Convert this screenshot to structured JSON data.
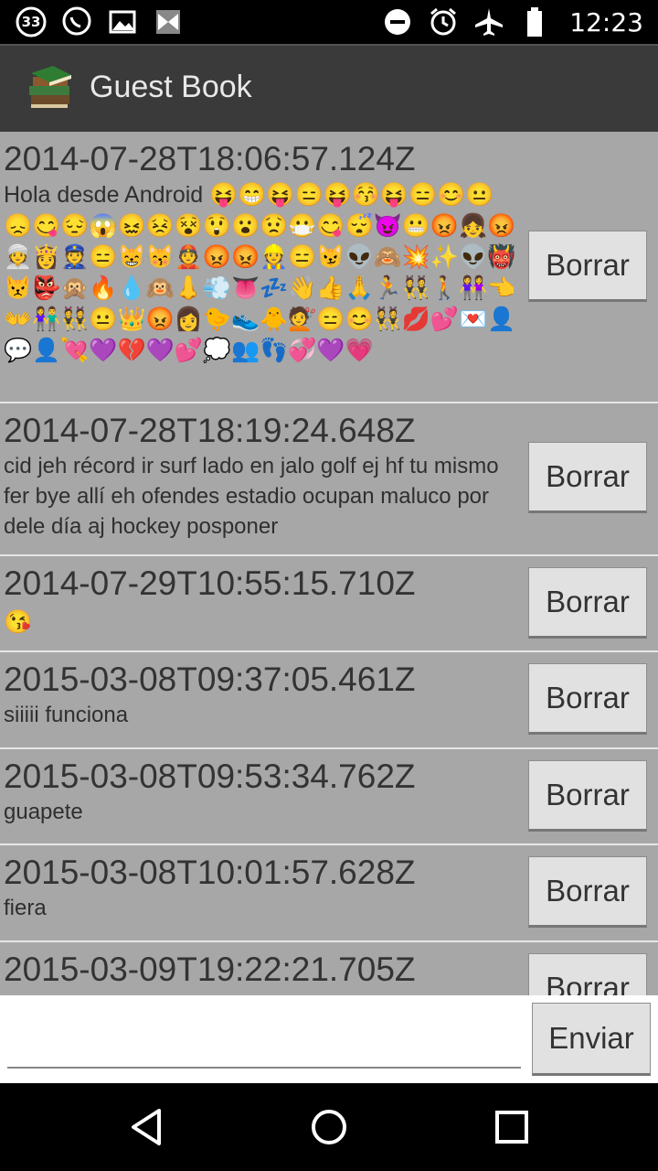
{
  "status": {
    "notification_count": "33",
    "time": "12:23"
  },
  "app": {
    "title": "Guest Book"
  },
  "entries": [
    {
      "date": "2014-07-28T18:06:57.124Z",
      "message": "Hola desde Android 😝😁😝😑😝😚😝😑😊😐😞😋😔😱😖😣😵😲😮😟😷😋😴😈😬😡👧😡👳👸👮😑😸😽👲😡😡👷😑😼👽🙈💥✨👽👹😾👺🙊🔥💧🙉👃💨👅💤👋👍🙏🏃👯🚶👭👈👐👫👯😐👑😡👩🐤👟🐥💇😑😊👯💋💕💌👤💬👤💘💜💔💜💕💭👥👣💞💜💗",
      "delete_label": "Borrar"
    },
    {
      "date": "2014-07-28T18:19:24.648Z",
      "message": "cid jeh récord ir surf lado en jalo golf ej hf tu mismo fer bye allí eh ofendes estadio ocupan maluco por dele día aj hockey posponer",
      "delete_label": "Borrar"
    },
    {
      "date": "2014-07-29T10:55:15.710Z",
      "message": "😘",
      "delete_label": "Borrar"
    },
    {
      "date": "2015-03-08T09:37:05.461Z",
      "message": "siiiii funciona",
      "delete_label": "Borrar"
    },
    {
      "date": "2015-03-08T09:53:34.762Z",
      "message": "guapete",
      "delete_label": "Borrar"
    },
    {
      "date": "2015-03-08T10:01:57.628Z",
      "message": "fiera",
      "delete_label": "Borrar"
    },
    {
      "date": "2015-03-09T19:22:21.705Z",
      "message": "",
      "delete_label": "Borrar"
    }
  ],
  "composer": {
    "input_value": "",
    "send_label": "Enviar"
  },
  "icons": {
    "status_left": [
      "notification-count-icon",
      "whatsapp-icon",
      "gallery-icon",
      "bowtie-icon"
    ],
    "status_right": [
      "do-not-disturb-icon",
      "alarm-icon",
      "airplane-mode-icon",
      "battery-icon"
    ],
    "nav": [
      "back-icon",
      "home-icon",
      "recents-icon"
    ]
  }
}
